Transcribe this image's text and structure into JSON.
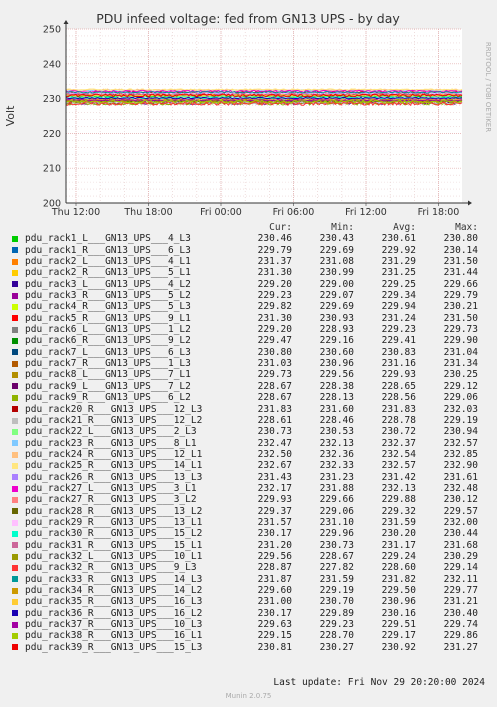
{
  "chart_data": {
    "type": "line",
    "title": "PDU infeed voltage: fed from GN13 UPS - by day",
    "ylabel": "Volt",
    "xlabel": "",
    "ylim": [
      200,
      250
    ],
    "yticks": [
      200,
      210,
      220,
      230,
      240,
      250
    ],
    "xticks": [
      "Thu 12:00",
      "Thu 18:00",
      "Fri 00:00",
      "Fri 06:00",
      "Fri 12:00",
      "Fri 18:00"
    ],
    "side_label": "RRDTOOL / TOBI OETIKER",
    "grid": true,
    "columns": [
      "Cur:",
      "Min:",
      "Avg:",
      "Max:"
    ],
    "series": [
      {
        "name": "pdu_rack1_L___GN13_UPS___4_L3",
        "color": "#00cc00",
        "cur": "230.46",
        "min": "230.43",
        "avg": "230.61",
        "max": "230.80"
      },
      {
        "name": "pdu_rack1_R___GN13_UPS___6_L3",
        "color": "#0066b3",
        "cur": "229.79",
        "min": "229.69",
        "avg": "229.92",
        "max": "230.14"
      },
      {
        "name": "pdu_rack2_L___GN13_UPS___4_L1",
        "color": "#ff8000",
        "cur": "231.37",
        "min": "231.08",
        "avg": "231.29",
        "max": "231.50"
      },
      {
        "name": "pdu_rack2_R___GN13_UPS___5_L1",
        "color": "#ffcc00",
        "cur": "231.30",
        "min": "230.99",
        "avg": "231.25",
        "max": "231.44"
      },
      {
        "name": "pdu_rack3_L___GN13_UPS___4_L2",
        "color": "#330099",
        "cur": "229.20",
        "min": "229.00",
        "avg": "229.25",
        "max": "229.66"
      },
      {
        "name": "pdu_rack3_R___GN13_UPS___5_L2",
        "color": "#990099",
        "cur": "229.23",
        "min": "229.07",
        "avg": "229.34",
        "max": "229.79"
      },
      {
        "name": "pdu_rack4_R___GN13_UPS___5_L3",
        "color": "#ccff00",
        "cur": "229.82",
        "min": "229.69",
        "avg": "229.94",
        "max": "230.21"
      },
      {
        "name": "pdu_rack5_R___GN13_UPS___9_L1",
        "color": "#ff0000",
        "cur": "231.30",
        "min": "230.93",
        "avg": "231.24",
        "max": "231.50"
      },
      {
        "name": "pdu_rack6_L___GN13_UPS___1_L2",
        "color": "#808080",
        "cur": "229.20",
        "min": "228.93",
        "avg": "229.23",
        "max": "229.73"
      },
      {
        "name": "pdu_rack6_R___GN13_UPS___9_L2",
        "color": "#008f00",
        "cur": "229.47",
        "min": "229.16",
        "avg": "229.41",
        "max": "229.90"
      },
      {
        "name": "pdu_rack7_L___GN13_UPS___6_L3",
        "color": "#00487d",
        "cur": "230.80",
        "min": "230.60",
        "avg": "230.83",
        "max": "231.04"
      },
      {
        "name": "pdu_rack7_R___GN13_UPS___1_L3",
        "color": "#b35a00",
        "cur": "231.03",
        "min": "230.96",
        "avg": "231.16",
        "max": "231.34"
      },
      {
        "name": "pdu_rack8_L___GN13_UPS___7_L1",
        "color": "#b38f00",
        "cur": "229.73",
        "min": "229.56",
        "avg": "229.93",
        "max": "230.25"
      },
      {
        "name": "pdu_rack9_L___GN13_UPS___7_L2",
        "color": "#6b006b",
        "cur": "228.67",
        "min": "228.38",
        "avg": "228.65",
        "max": "229.12"
      },
      {
        "name": "pdu_rack9_R___GN13_UPS___6_L2",
        "color": "#8fb300",
        "cur": "228.67",
        "min": "228.13",
        "avg": "228.56",
        "max": "229.06"
      },
      {
        "name": "pdu_rack20_R___GN13_UPS___12_L3",
        "color": "#b30000",
        "cur": "231.83",
        "min": "231.60",
        "avg": "231.83",
        "max": "232.03"
      },
      {
        "name": "pdu_rack21_R___GN13_UPS___12_L2",
        "color": "#bebebe",
        "cur": "228.61",
        "min": "228.46",
        "avg": "228.78",
        "max": "229.19"
      },
      {
        "name": "pdu_rack22_L___GN13_UPS___2_L3",
        "color": "#80ff80",
        "cur": "230.73",
        "min": "230.53",
        "avg": "230.72",
        "max": "230.94"
      },
      {
        "name": "pdu_rack23_R___GN13_UPS___8_L1",
        "color": "#80c9ff",
        "cur": "232.47",
        "min": "232.13",
        "avg": "232.37",
        "max": "232.57"
      },
      {
        "name": "pdu_rack24_R___GN13_UPS___12_L1",
        "color": "#ffc080",
        "cur": "232.50",
        "min": "232.36",
        "avg": "232.54",
        "max": "232.85"
      },
      {
        "name": "pdu_rack25_R___GN13_UPS___14_L1",
        "color": "#ffe680",
        "cur": "232.67",
        "min": "232.33",
        "avg": "232.57",
        "max": "232.90"
      },
      {
        "name": "pdu_rack26_R___GN13_UPS___13_L3",
        "color": "#aa80ff",
        "cur": "231.43",
        "min": "231.23",
        "avg": "231.42",
        "max": "231.61"
      },
      {
        "name": "pdu_rack27_L___GN13_UPS___3_L1",
        "color": "#ee00cc",
        "cur": "232.17",
        "min": "231.88",
        "avg": "232.13",
        "max": "232.48"
      },
      {
        "name": "pdu_rack27_R___GN13_UPS___3_L2",
        "color": "#ff8080",
        "cur": "229.93",
        "min": "229.66",
        "avg": "229.88",
        "max": "230.12"
      },
      {
        "name": "pdu_rack28_R___GN13_UPS___13_L2",
        "color": "#666600",
        "cur": "229.37",
        "min": "229.06",
        "avg": "229.32",
        "max": "229.57"
      },
      {
        "name": "pdu_rack29_R___GN13_UPS___13_L1",
        "color": "#ffbfff",
        "cur": "231.57",
        "min": "231.10",
        "avg": "231.59",
        "max": "232.00"
      },
      {
        "name": "pdu_rack30_R___GN13_UPS___15_L2",
        "color": "#00ffcc",
        "cur": "230.17",
        "min": "229.96",
        "avg": "230.20",
        "max": "230.44"
      },
      {
        "name": "pdu_rack31_R___GN13_UPS___15_L1",
        "color": "#cc6699",
        "cur": "231.20",
        "min": "230.73",
        "avg": "231.17",
        "max": "231.68"
      },
      {
        "name": "pdu_rack32_L___GN13_UPS___10_L1",
        "color": "#999900",
        "cur": "229.56",
        "min": "228.67",
        "avg": "229.24",
        "max": "230.29"
      },
      {
        "name": "pdu_rack32_R___GN13_UPS___9_L3",
        "color": "#ff3333",
        "cur": "228.87",
        "min": "227.82",
        "avg": "228.60",
        "max": "229.14"
      },
      {
        "name": "pdu_rack33_R___GN13_UPS___14_L3",
        "color": "#009999",
        "cur": "231.87",
        "min": "231.59",
        "avg": "231.82",
        "max": "232.11"
      },
      {
        "name": "pdu_rack34_R___GN13_UPS___14_L2",
        "color": "#cc9900",
        "cur": "229.60",
        "min": "229.19",
        "avg": "229.50",
        "max": "229.77"
      },
      {
        "name": "pdu_rack35_R___GN13_UPS___16_L3",
        "color": "#ffcc33",
        "cur": "231.00",
        "min": "230.70",
        "avg": "230.96",
        "max": "231.21"
      },
      {
        "name": "pdu_rack36_R___GN13_UPS___16_L2",
        "color": "#1a00b3",
        "cur": "230.17",
        "min": "229.89",
        "avg": "230.16",
        "max": "230.40"
      },
      {
        "name": "pdu_rack37_R___GN13_UPS___10_L3",
        "color": "#a300a3",
        "cur": "229.63",
        "min": "229.23",
        "avg": "229.51",
        "max": "229.74"
      },
      {
        "name": "pdu_rack38_R___GN13_UPS___16_L1",
        "color": "#a3cc00",
        "cur": "229.15",
        "min": "228.70",
        "avg": "229.17",
        "max": "229.86"
      },
      {
        "name": "pdu_rack39_R___GN13_UPS___15_L3",
        "color": "#ee0000",
        "cur": "230.81",
        "min": "230.27",
        "avg": "230.92",
        "max": "231.27"
      }
    ]
  },
  "footer": {
    "last_update": "Last update: Fri Nov 29 20:20:00 2024",
    "version": "Munin 2.0.75"
  }
}
